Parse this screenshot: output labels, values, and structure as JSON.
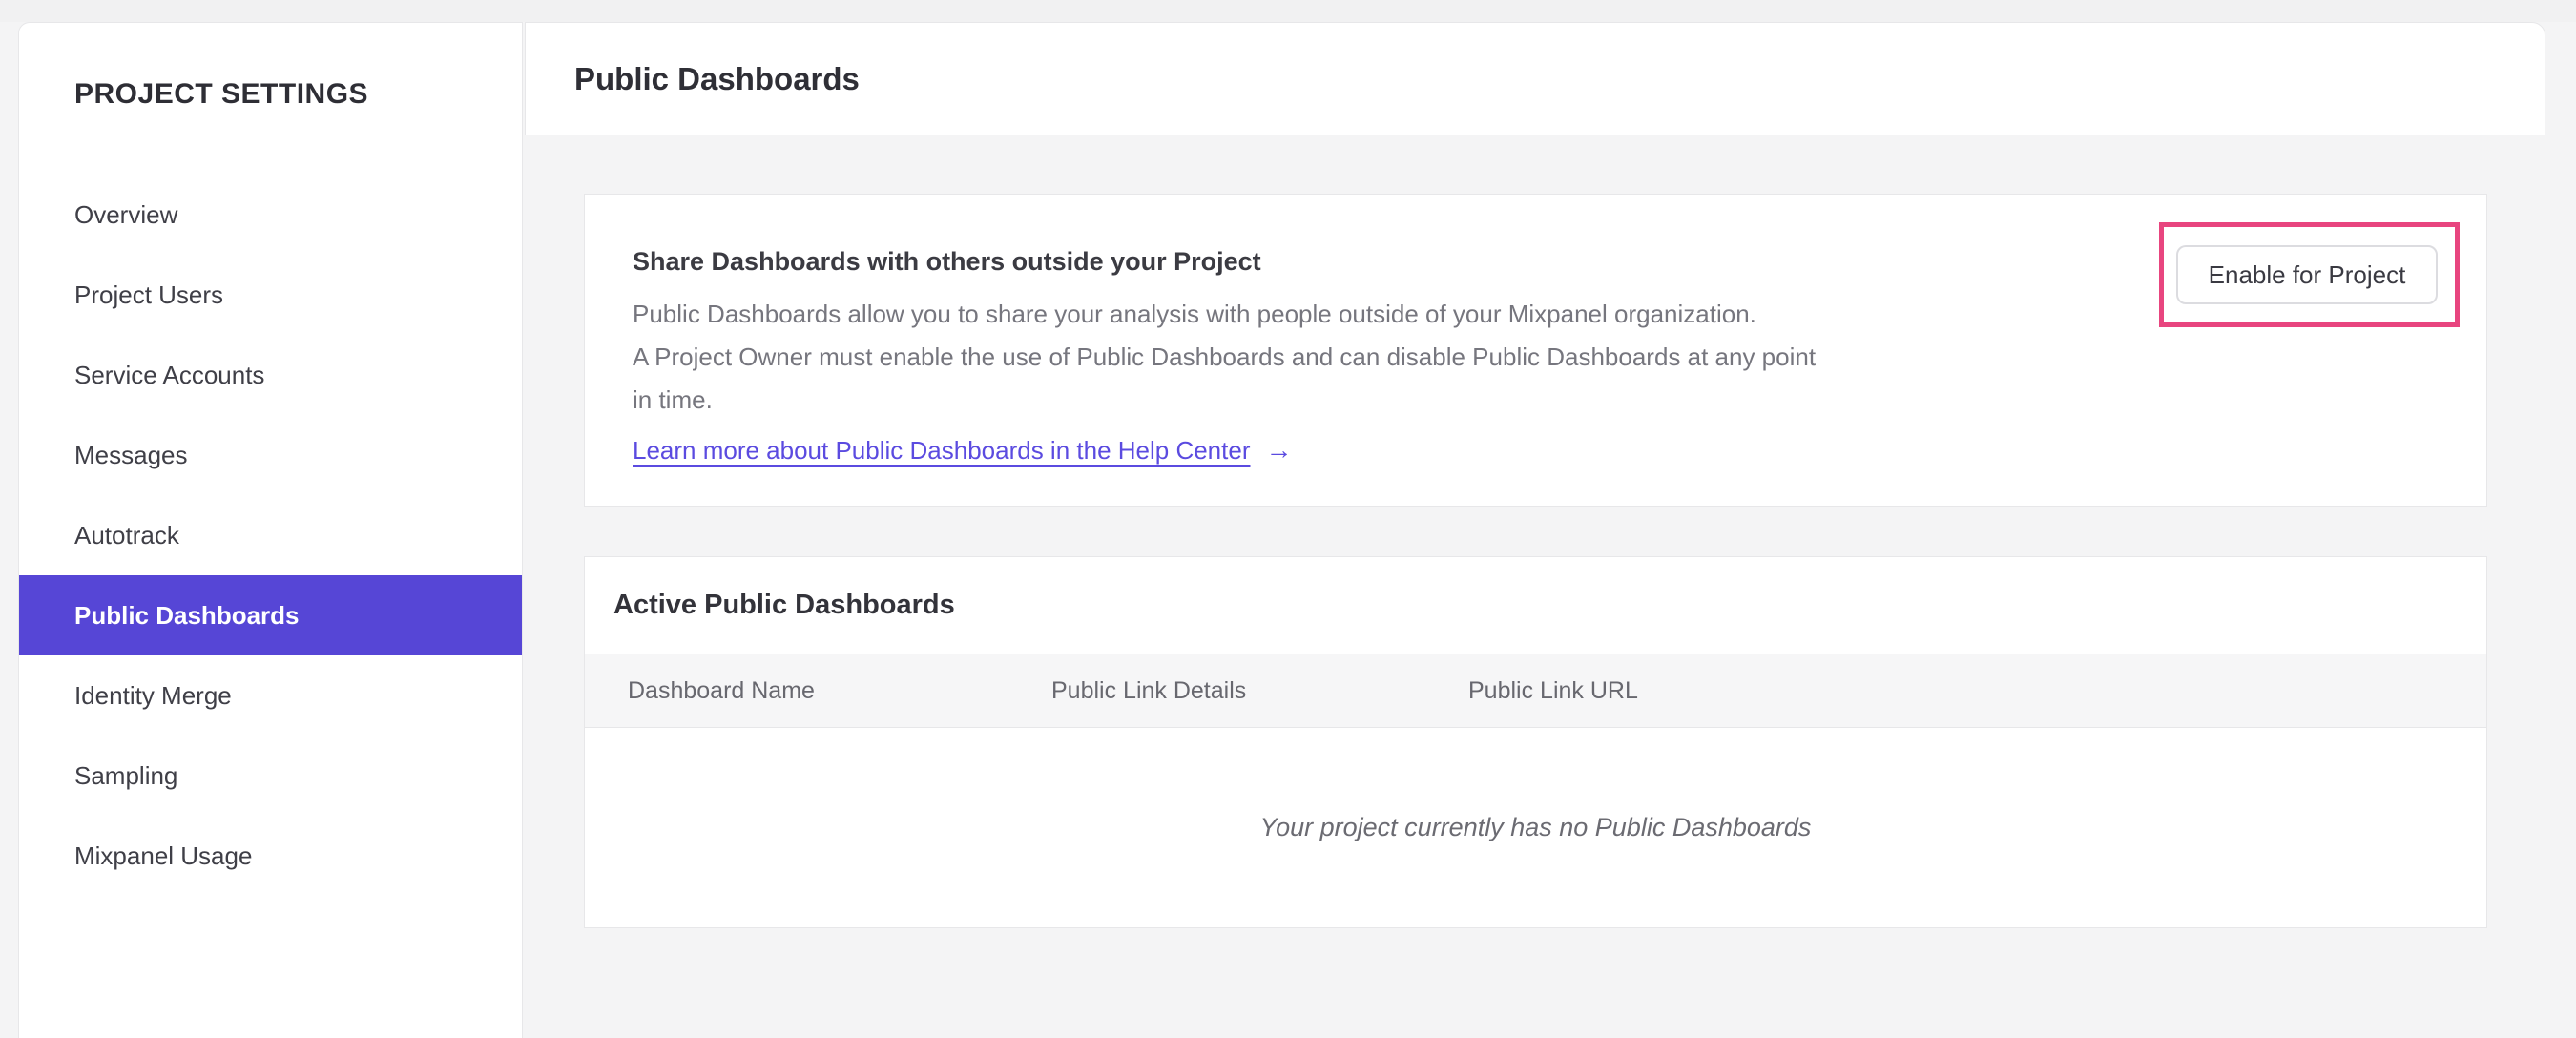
{
  "sidebar": {
    "title": "PROJECT SETTINGS",
    "items": [
      {
        "label": "Overview",
        "selected": false
      },
      {
        "label": "Project Users",
        "selected": false
      },
      {
        "label": "Service Accounts",
        "selected": false
      },
      {
        "label": "Messages",
        "selected": false
      },
      {
        "label": "Autotrack",
        "selected": false
      },
      {
        "label": "Public Dashboards",
        "selected": true
      },
      {
        "label": "Identity Merge",
        "selected": false
      },
      {
        "label": "Sampling",
        "selected": false
      },
      {
        "label": "Mixpanel Usage",
        "selected": false
      }
    ]
  },
  "header": {
    "title": "Public Dashboards"
  },
  "share_card": {
    "heading": "Share Dashboards with others outside your Project",
    "description_lines": [
      "Public Dashboards allow you to share your analysis with people outside of your Mixpanel organization.",
      "A Project Owner must enable the use of Public Dashboards and can disable Public Dashboards at any point",
      "in time."
    ],
    "link_label": "Learn more about Public Dashboards in the Help Center",
    "link_arrow": "→",
    "enable_button_label": "Enable for Project"
  },
  "active_card": {
    "heading": "Active Public Dashboards",
    "table": {
      "columns": [
        "Dashboard Name",
        "Public Link Details",
        "Public Link URL"
      ],
      "rows": [],
      "empty_message": "Your project currently has no Public Dashboards"
    }
  },
  "colors": {
    "accent": "#5646d6",
    "link": "#5b4be0",
    "annotation": "#e8457f"
  }
}
